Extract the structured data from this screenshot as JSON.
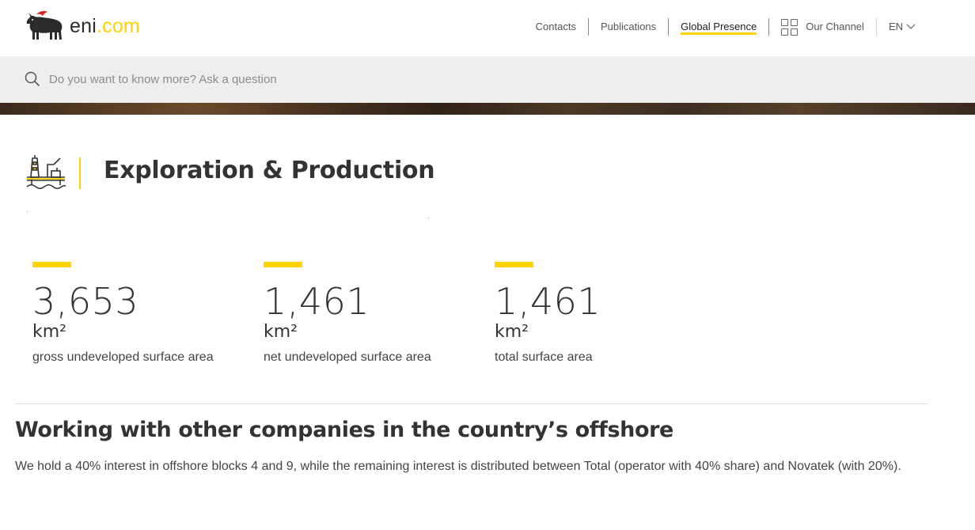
{
  "header": {
    "logo_text": "eni",
    "logo_dot": ".",
    "logo_com": "com",
    "nav": {
      "contacts": "Contacts",
      "publications": "Publications",
      "global_presence": "Global Presence",
      "our_channel": "Our Channel",
      "language": "EN"
    }
  },
  "search": {
    "placeholder": "Do you want to know more? Ask a question"
  },
  "section": {
    "title": "Exploration & Production"
  },
  "stats": [
    {
      "value": "3,653",
      "unit": "km²",
      "label": "gross undeveloped surface area"
    },
    {
      "value": "1,461",
      "unit": "km²",
      "label": "net undeveloped surface area"
    },
    {
      "value": "1,461",
      "unit": "km²",
      "label": "total surface area"
    }
  ],
  "article": {
    "heading": "Working with other companies in the country’s offshore",
    "paragraph": "We hold a 40% interest in offshore blocks 4 and 9, while the remaining interest is distributed between Total (operator with 40% share) and Novatek (with 20%)."
  },
  "colors": {
    "accent": "#ffd200",
    "text": "#333333",
    "search_bg": "#eeeeee"
  },
  "icons": [
    "six-legged-dog-logo-icon",
    "grid-icon",
    "chevron-down-icon",
    "search-icon",
    "offshore-platform-icon"
  ]
}
